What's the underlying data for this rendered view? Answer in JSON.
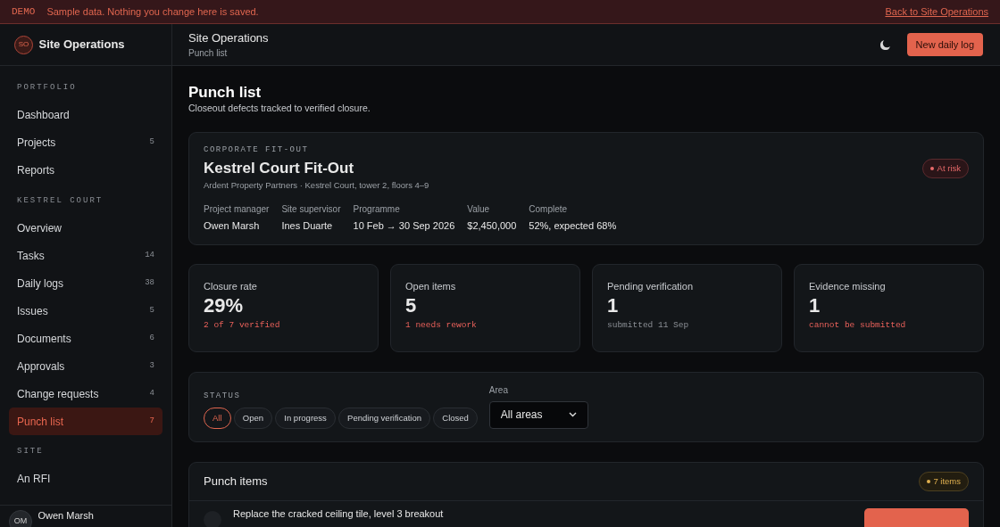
{
  "banner": {
    "tag": "DEMO",
    "message": "Sample data. Nothing you change here is saved.",
    "link": "Back to Site Operations"
  },
  "brand": {
    "initials": "SO",
    "name": "Site Operations"
  },
  "sidebar": {
    "sections": [
      {
        "title": "PORTFOLIO",
        "items": [
          {
            "label": "Dashboard",
            "selected": false
          },
          {
            "label": "Projects",
            "count": "5",
            "selected": false
          },
          {
            "label": "Reports",
            "selected": false
          }
        ]
      },
      {
        "title": "KESTREL COURT",
        "items": [
          {
            "label": "Overview",
            "selected": false
          },
          {
            "label": "Tasks",
            "count": "14",
            "selected": false
          },
          {
            "label": "Daily logs",
            "count": "38",
            "selected": false
          },
          {
            "label": "Issues",
            "count": "5",
            "selected": false
          },
          {
            "label": "Documents",
            "count": "6",
            "selected": false
          },
          {
            "label": "Approvals",
            "count": "3",
            "selected": false
          },
          {
            "label": "Change requests",
            "count": "4",
            "selected": false
          },
          {
            "label": "Punch list",
            "count": "7",
            "selected": true
          }
        ]
      },
      {
        "title": "SITE",
        "items": [
          {
            "label": "An RFI",
            "selected": false
          }
        ]
      }
    ],
    "user": {
      "initials": "OM",
      "name": "Owen Marsh"
    }
  },
  "header": {
    "title": "Site Operations",
    "subtitle": "Punch list",
    "button": "New daily log"
  },
  "page": {
    "title": "Punch list",
    "subtitle": "Closeout defects tracked to verified closure."
  },
  "project": {
    "eyebrow": "CORPORATE FIT-OUT",
    "name": "Kestrel Court Fit-Out",
    "meta": "Ardent Property Partners · Kestrel Court, tower 2, floors 4–9",
    "status": "At risk",
    "facts": [
      {
        "label": "Project manager",
        "value": "Owen Marsh"
      },
      {
        "label": "Site supervisor",
        "value": "Ines Duarte"
      },
      {
        "label": "Programme",
        "value": "10 Feb → 30 Sep 2026"
      },
      {
        "label": "Value",
        "value": "$2,450,000"
      },
      {
        "label": "Complete",
        "value": "52%, expected 68%"
      }
    ]
  },
  "stats": [
    {
      "label": "Closure rate",
      "value": "29%",
      "note": "2 of 7 verified",
      "alert": true
    },
    {
      "label": "Open items",
      "value": "5",
      "note": "1 needs rework",
      "alert": true
    },
    {
      "label": "Pending verification",
      "value": "1",
      "note": "submitted 11 Sep",
      "alert": false
    },
    {
      "label": "Evidence missing",
      "value": "1",
      "note": "cannot be submitted",
      "alert": true
    }
  ],
  "filters": {
    "status_label": "STATUS",
    "statuses": [
      {
        "label": "All",
        "selected": true
      },
      {
        "label": "Open",
        "selected": false
      },
      {
        "label": "In progress",
        "selected": false
      },
      {
        "label": "Pending verification",
        "selected": false
      },
      {
        "label": "Closed",
        "selected": false
      }
    ],
    "area_label": "Area",
    "area_value": "All areas"
  },
  "punch_items": {
    "title": "Punch items",
    "count": "7 items",
    "rows": [
      {
        "title": "Replace the cracked ceiling tile, level 3 breakout"
      }
    ]
  }
}
